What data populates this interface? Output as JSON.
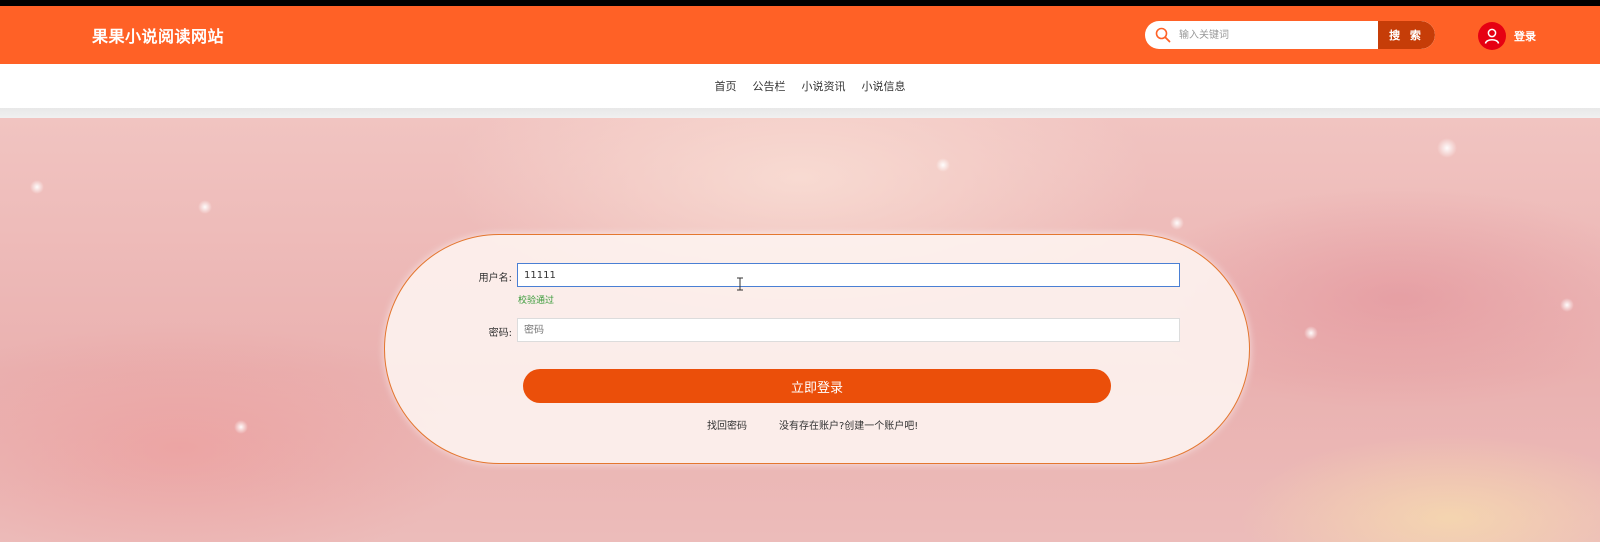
{
  "header": {
    "site_title": "果果小说阅读网站",
    "search_placeholder": "输入关键词",
    "search_button": "搜 索",
    "login_label": "登录",
    "icons": {
      "search": "search-icon",
      "avatar": "user-avatar-icon"
    },
    "colors": {
      "header_bg": "#ff6126",
      "search_btn": "#c63d08",
      "avatar_bg": "#e60012"
    }
  },
  "nav": {
    "items": [
      "首页",
      "公告栏",
      "小说资讯",
      "小说信息"
    ]
  },
  "login_form": {
    "username_label": "用户名:",
    "username_value": "11111",
    "username_validation": "校验通过",
    "password_label": "密码:",
    "password_placeholder": "密码",
    "submit_label": "立即登录",
    "forgot_password_link": "找回密码",
    "register_link": "没有存在账户?创建一个账户吧!",
    "colors": {
      "submit_bg": "#eb4f0a",
      "valid": "#3a9b3a",
      "card_border": "#e4772f"
    }
  }
}
